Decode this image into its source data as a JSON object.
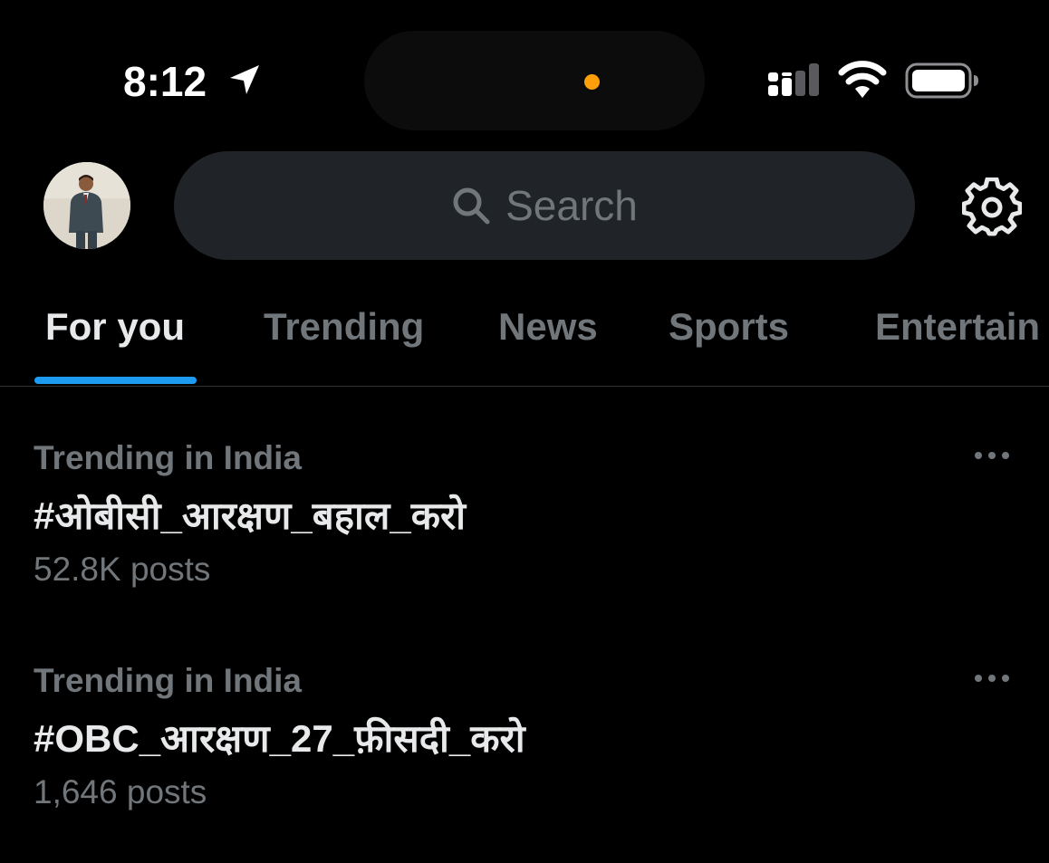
{
  "status_bar": {
    "time": "8:12",
    "icons": [
      "location-arrow-icon",
      "signal-icon",
      "wifi-icon",
      "battery-icon"
    ],
    "island_dot_color": "#ff9f0a"
  },
  "header": {
    "search": {
      "placeholder": "Search",
      "icon": "search-icon"
    },
    "settings_icon": "gear-icon"
  },
  "tabs": [
    {
      "label": "For you",
      "active": true
    },
    {
      "label": "Trending",
      "active": false
    },
    {
      "label": "News",
      "active": false
    },
    {
      "label": "Sports",
      "active": false
    },
    {
      "label": "Entertain",
      "active": false
    }
  ],
  "trends": [
    {
      "context": "Trending in India",
      "name": "#ओबीसी_आरक्षण_बहाल_करो",
      "count": "52.8K posts"
    },
    {
      "context": "Trending in India",
      "name": "#OBC_आरक्षण_27_फ़ीसदी_करो",
      "count": "1,646 posts"
    }
  ],
  "colors": {
    "background": "#000000",
    "accent": "#1d9bf0",
    "primary_text": "#e7e9ea",
    "secondary_text": "#71767b",
    "search_bg": "#202327"
  }
}
